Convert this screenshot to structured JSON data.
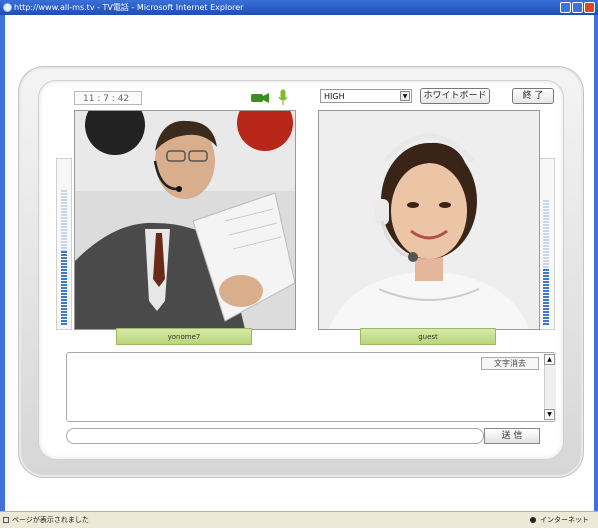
{
  "window": {
    "title": "http://www.all-ms.tv - TV電話 - Microsoft Internet Explorer",
    "status_text": "ページが表示されました",
    "zone_text": "インターネット"
  },
  "toolbar": {
    "clock": "11 : 7 : 42",
    "quality_value": "HIGH",
    "whiteboard_label": "ホワイトボード",
    "end_label": "終 了"
  },
  "video": {
    "left_name": "yonome7",
    "right_name": "guest"
  },
  "meters": {
    "left_level": 0.55,
    "right_level": 0.45
  },
  "chat": {
    "clear_label": "文字消去",
    "send_label": "送 信",
    "input_value": ""
  },
  "colors": {
    "accent": "#b9d57a",
    "frame": "#3f72d9"
  }
}
